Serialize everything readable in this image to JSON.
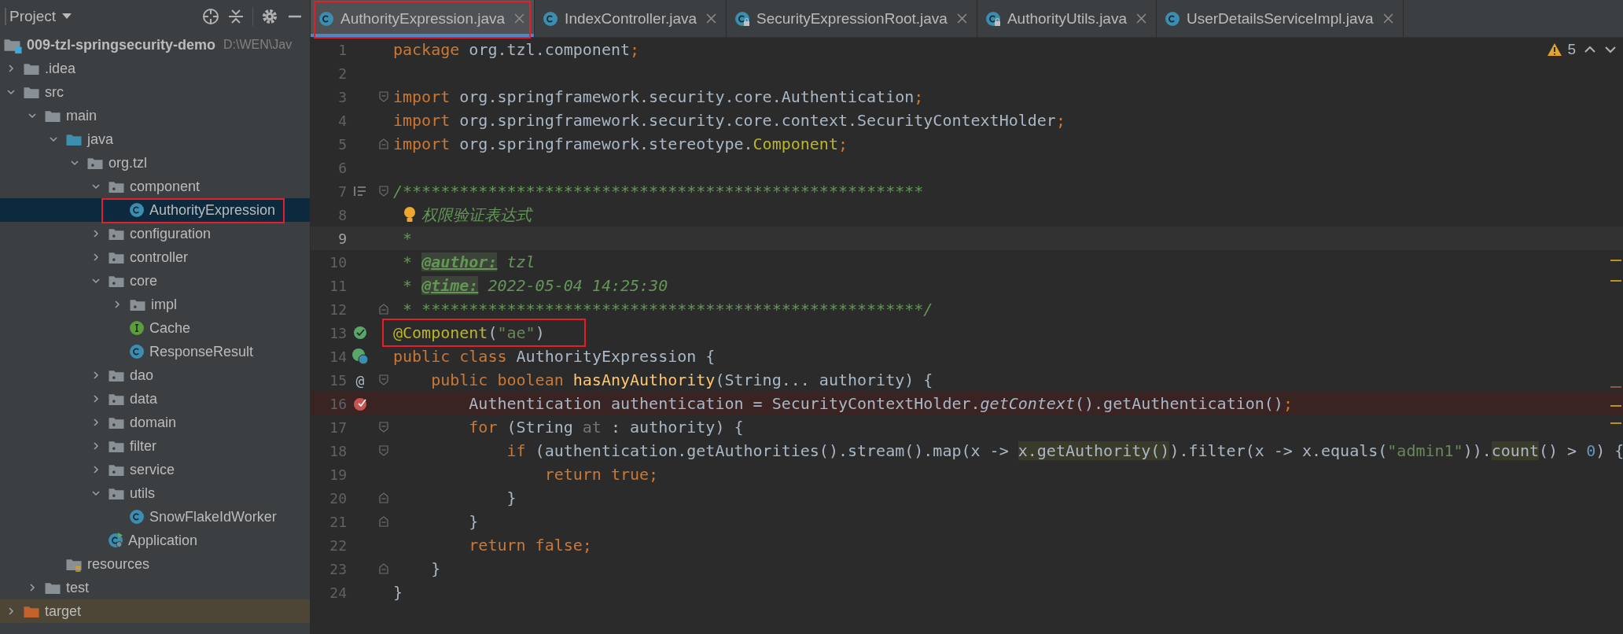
{
  "project_panel": {
    "title": "Project",
    "root": {
      "name": "009-tzl-springsecurity-demo",
      "path": "D:\\WEN\\Jav"
    },
    "tree": [
      {
        "label": ".idea",
        "kind": "folder",
        "expanded": false,
        "selected": false
      },
      {
        "label": "src",
        "kind": "folder",
        "expanded": true,
        "selected": false,
        "children": [
          {
            "label": "main",
            "kind": "folder",
            "expanded": true,
            "selected": false,
            "children": [
              {
                "label": "java",
                "kind": "source-folder",
                "expanded": true,
                "selected": false,
                "children": [
                  {
                    "label": "org.tzl",
                    "kind": "package",
                    "expanded": true,
                    "selected": false,
                    "children": [
                      {
                        "label": "component",
                        "kind": "package",
                        "expanded": true,
                        "selected": false,
                        "children": [
                          {
                            "label": "AuthorityExpression",
                            "kind": "class",
                            "selected": true,
                            "marked": true
                          }
                        ]
                      },
                      {
                        "label": "configuration",
                        "kind": "package",
                        "expanded": false,
                        "selected": false
                      },
                      {
                        "label": "controller",
                        "kind": "package",
                        "expanded": false,
                        "selected": false
                      },
                      {
                        "label": "core",
                        "kind": "package",
                        "expanded": true,
                        "selected": false,
                        "children": [
                          {
                            "label": "impl",
                            "kind": "package",
                            "expanded": false,
                            "selected": false
                          },
                          {
                            "label": "Cache",
                            "kind": "interface",
                            "selected": false
                          },
                          {
                            "label": "ResponseResult",
                            "kind": "class",
                            "selected": false
                          }
                        ]
                      },
                      {
                        "label": "dao",
                        "kind": "package",
                        "expanded": false,
                        "selected": false
                      },
                      {
                        "label": "data",
                        "kind": "package",
                        "expanded": false,
                        "selected": false
                      },
                      {
                        "label": "domain",
                        "kind": "package",
                        "expanded": false,
                        "selected": false
                      },
                      {
                        "label": "filter",
                        "kind": "package",
                        "expanded": false,
                        "selected": false
                      },
                      {
                        "label": "service",
                        "kind": "package",
                        "expanded": false,
                        "selected": false
                      },
                      {
                        "label": "utils",
                        "kind": "package",
                        "expanded": true,
                        "selected": false,
                        "children": [
                          {
                            "label": "SnowFlakeIdWorker",
                            "kind": "class",
                            "selected": false
                          }
                        ]
                      },
                      {
                        "label": "Application",
                        "kind": "app",
                        "selected": false
                      }
                    ]
                  }
                ]
              },
              {
                "label": "resources",
                "kind": "resources",
                "selected": false
              }
            ]
          },
          {
            "label": "test",
            "kind": "folder",
            "expanded": false,
            "selected": false
          }
        ]
      },
      {
        "label": "target",
        "kind": "excluded",
        "expanded": false,
        "selected": false
      }
    ]
  },
  "tabs": [
    {
      "label": "AuthorityExpression.java",
      "readonly": false,
      "selected": true,
      "marked": true
    },
    {
      "label": "IndexController.java",
      "readonly": false,
      "selected": false
    },
    {
      "label": "SecurityExpressionRoot.java",
      "readonly": true,
      "selected": false
    },
    {
      "label": "AuthorityUtils.java",
      "readonly": true,
      "selected": false
    },
    {
      "label": "UserDetailsServiceImpl.java",
      "readonly": false,
      "selected": false
    }
  ],
  "inspections": {
    "warnings": "5"
  },
  "lines": [
    {
      "n": "1",
      "tokens": [
        {
          "t": "package",
          "kind": "kw"
        },
        {
          "t": " org.tzl.component",
          "kind": "plain"
        },
        {
          "t": ";",
          "kind": "kw"
        }
      ]
    },
    {
      "n": "2"
    },
    {
      "n": "3",
      "fold": {
        "kind": "open"
      },
      "tokens": [
        {
          "t": "import",
          "kind": "kw"
        },
        {
          "t": " org.springframework.security.core.Authentication",
          "kind": "plain"
        },
        {
          "t": ";",
          "kind": "kw"
        }
      ]
    },
    {
      "n": "4",
      "tokens": [
        {
          "t": "import",
          "kind": "kw"
        },
        {
          "t": " org.springframework.security.core.context.SecurityContextHolder",
          "kind": "plain"
        },
        {
          "t": ";",
          "kind": "kw"
        }
      ]
    },
    {
      "n": "5",
      "fold": {
        "kind": "close"
      },
      "tokens": [
        {
          "t": "import",
          "kind": "kw"
        },
        {
          "t": " org.springframework.stereotype.",
          "kind": "plain"
        },
        {
          "t": "Component",
          "kind": "ann"
        },
        {
          "t": ";",
          "kind": "kw"
        }
      ]
    },
    {
      "n": "6"
    },
    {
      "n": "7",
      "fold": {
        "kind": "open"
      },
      "gutter": {
        "kind": "reader"
      },
      "tokens": [
        {
          "t": "/*******************************************************",
          "kind": "doc"
        }
      ]
    },
    {
      "n": "8",
      "bulb": true,
      "tokens": [
        {
          "t": "权限验证表达式",
          "kind": "doc"
        }
      ]
    },
    {
      "n": "9",
      "caret": true,
      "tokens": [
        {
          "t": " *",
          "kind": "doc"
        }
      ]
    },
    {
      "n": "10",
      "tokens": [
        {
          "t": " * ",
          "kind": "doc"
        },
        {
          "t": "@author:",
          "kind": "doctag"
        },
        {
          "t": " tzl",
          "kind": "doc"
        }
      ]
    },
    {
      "n": "11",
      "tokens": [
        {
          "t": " * ",
          "kind": "doc"
        },
        {
          "t": "@time:",
          "kind": "doctag"
        },
        {
          "t": " 2022-05-04 14:25:30",
          "kind": "doc"
        }
      ]
    },
    {
      "n": "12",
      "fold": {
        "kind": "close"
      },
      "tokens": [
        {
          "t": " * *****************************************************/",
          "kind": "doc"
        }
      ]
    },
    {
      "n": "13",
      "gutter": {
        "kind": "bean"
      },
      "marked": true,
      "tokens": [
        {
          "t": "@Component",
          "kind": "ann"
        },
        {
          "t": "(",
          "kind": "plain"
        },
        {
          "t": "\"ae\"",
          "kind": "str"
        },
        {
          "t": ")",
          "kind": "plain"
        }
      ]
    },
    {
      "n": "14",
      "gutter": {
        "kind": "bean-class"
      },
      "tokens": [
        {
          "t": "public class ",
          "kind": "kw"
        },
        {
          "t": "AuthorityExpression {",
          "kind": "plain"
        }
      ]
    },
    {
      "n": "15",
      "fold": {
        "kind": "open"
      },
      "gutter": {
        "kind": "text",
        "text": "@"
      },
      "tokens": [
        {
          "t": "    public boolean ",
          "kind": "kw"
        },
        {
          "t": "hasAnyAuthority",
          "kind": "fn"
        },
        {
          "t": "(String... authority) {",
          "kind": "plain"
        }
      ]
    },
    {
      "n": "16",
      "gutter": {
        "kind": "breakpoint"
      },
      "breakpoint": true,
      "tokens": [
        {
          "t": "        Authentication authentication = SecurityContextHolder.",
          "kind": "plain"
        },
        {
          "t": "getContext",
          "kind": "italic"
        },
        {
          "t": "().getAuthentication()",
          "kind": "plain"
        },
        {
          "t": ";",
          "kind": "kw"
        }
      ]
    },
    {
      "n": "17",
      "fold": {
        "kind": "open"
      },
      "tokens": [
        {
          "t": "        for",
          "kind": "kw"
        },
        {
          "t": " (String ",
          "kind": "plain"
        },
        {
          "t": "at",
          "kind": "unused"
        },
        {
          "t": " : authority) {",
          "kind": "plain"
        }
      ]
    },
    {
      "n": "18",
      "fold": {
        "kind": "open"
      },
      "tokens": [
        {
          "t": "            if",
          "kind": "kw"
        },
        {
          "t": " (authentication.getAuthorities().stream().map(x -> ",
          "kind": "plain"
        },
        {
          "t": "x.getAuthority()",
          "kind": "hl"
        },
        {
          "t": ").filter(x -> x.equals(",
          "kind": "plain"
        },
        {
          "t": "\"admin1\"",
          "kind": "str"
        },
        {
          "t": ")).",
          "kind": "plain"
        },
        {
          "t": "count",
          "kind": "hl"
        },
        {
          "t": "() > ",
          "kind": "plain"
        },
        {
          "t": "0",
          "kind": "num"
        },
        {
          "t": ") {",
          "kind": "plain"
        }
      ]
    },
    {
      "n": "19",
      "tokens": [
        {
          "t": "                return true",
          "kind": "kw"
        },
        {
          "t": ";",
          "kind": "kw"
        }
      ]
    },
    {
      "n": "20",
      "fold": {
        "kind": "close"
      },
      "tokens": [
        {
          "t": "            }",
          "kind": "plain"
        }
      ]
    },
    {
      "n": "21",
      "fold": {
        "kind": "close"
      },
      "tokens": [
        {
          "t": "        }",
          "kind": "plain"
        }
      ]
    },
    {
      "n": "22",
      "tokens": [
        {
          "t": "        return false",
          "kind": "kw"
        },
        {
          "t": ";",
          "kind": "kw"
        }
      ]
    },
    {
      "n": "23",
      "fold": {
        "kind": "close"
      },
      "tokens": [
        {
          "t": "    }",
          "kind": "plain"
        }
      ]
    },
    {
      "n": "24",
      "tokens": [
        {
          "t": "}",
          "kind": "plain"
        }
      ]
    }
  ]
}
